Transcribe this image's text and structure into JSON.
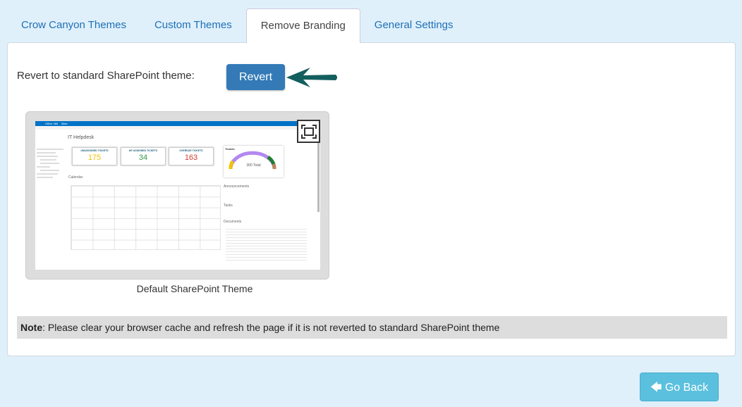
{
  "tabs": [
    {
      "label": "Crow Canyon Themes"
    },
    {
      "label": "Custom Themes"
    },
    {
      "label": "Remove Branding",
      "active": true
    },
    {
      "label": "General Settings"
    }
  ],
  "revert": {
    "label": "Revert to standard SharePoint theme:",
    "button": "Revert",
    "arrow_color": "#135e5e"
  },
  "thumbnail": {
    "caption": "Default SharePoint Theme",
    "topbar": {
      "app": "Office 365",
      "sites": "Sites"
    },
    "site_title": "IT Helpdesk",
    "tiles": [
      {
        "title": "UNASSIGNED TICKETS",
        "value": "175",
        "color": "#f2c200"
      },
      {
        "title": "MY ASSIGNED TICKETS",
        "value": "34",
        "color": "#2e9a44"
      },
      {
        "title": "OVERDUE TICKETS",
        "value": "163",
        "color": "#d43b2f"
      }
    ],
    "chart": {
      "title": "Tickets",
      "total": "300 Total"
    },
    "sections": {
      "calendar": "Calendar",
      "announcements": "Announcements",
      "tasks": "Tasks",
      "documents": "Documents"
    },
    "expand_icon": "expand-icon"
  },
  "note": {
    "label": "Note",
    "text": ": Please clear your browser cache and refresh the page if it is not reverted to standard SharePoint theme"
  },
  "go_back": {
    "label": "Go Back",
    "icon": "arrow-left-icon"
  },
  "colors": {
    "primary": "#337ab7",
    "info": "#5bc0de",
    "background": "#dff0fb"
  }
}
